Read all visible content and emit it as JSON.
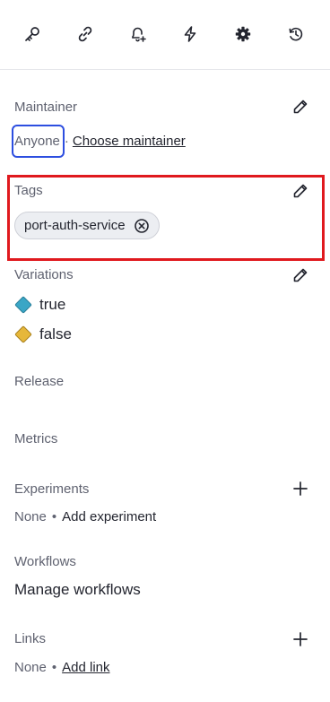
{
  "toolbar": {
    "icons": [
      "key-icon",
      "link-icon",
      "bell-plus-icon",
      "lightning-icon",
      "gear-icon",
      "history-icon"
    ]
  },
  "maintainer": {
    "title": "Maintainer",
    "value": "Anyone",
    "separator": "·",
    "action": "Choose maintainer"
  },
  "tags": {
    "title": "Tags",
    "items": [
      "port-auth-service"
    ]
  },
  "variations": {
    "title": "Variations",
    "items": [
      {
        "label": "true",
        "color": "#3aa6c6"
      },
      {
        "label": "false",
        "color": "#e6b73a"
      }
    ]
  },
  "release": {
    "title": "Release"
  },
  "metrics": {
    "title": "Metrics"
  },
  "experiments": {
    "title": "Experiments",
    "none": "None",
    "bullet": "•",
    "action": "Add experiment"
  },
  "workflows": {
    "title": "Workflows",
    "action": "Manage workflows"
  },
  "links": {
    "title": "Links",
    "none": "None",
    "bullet": "•",
    "action": "Add link"
  },
  "colors": {
    "focus": "#2d4ee0",
    "highlight": "#e0191e"
  }
}
